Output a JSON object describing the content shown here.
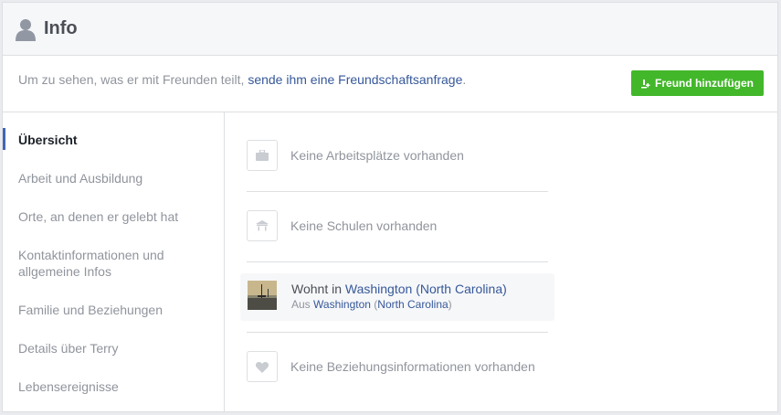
{
  "header": {
    "title": "Info",
    "icon": "person-icon"
  },
  "notice": {
    "text_before": "Um zu sehen, was er mit Freunden teilt, ",
    "link": "sende ihm eine Freundschaftsanfrage",
    "text_after": ".",
    "button_label": "Freund hinzufügen",
    "button_color": "#42b72a"
  },
  "sidebar": {
    "items": [
      {
        "label": "Übersicht",
        "active": true
      },
      {
        "label": "Arbeit und Ausbildung"
      },
      {
        "label": "Orte, an denen er gelebt hat"
      },
      {
        "label": "Kontaktinformationen und allgemeine Infos"
      },
      {
        "label": "Familie und Beziehungen"
      },
      {
        "label": "Details über Terry"
      },
      {
        "label": "Lebensereignisse"
      }
    ]
  },
  "main": {
    "work": {
      "label": "Keine Arbeitsplätze vorhanden",
      "icon": "briefcase-icon"
    },
    "school": {
      "label": "Keine Schulen vorhanden",
      "icon": "school-icon"
    },
    "lives": {
      "prefix": "Wohnt in ",
      "place": "Washington (North Carolina)",
      "from_prefix": "Aus ",
      "from_city": "Washington",
      "from_paren_open": " (",
      "from_state": "North Carolina",
      "from_paren_close": ")"
    },
    "relationship": {
      "label": "Keine Beziehungsinformationen vorhanden",
      "icon": "heart-icon"
    }
  }
}
